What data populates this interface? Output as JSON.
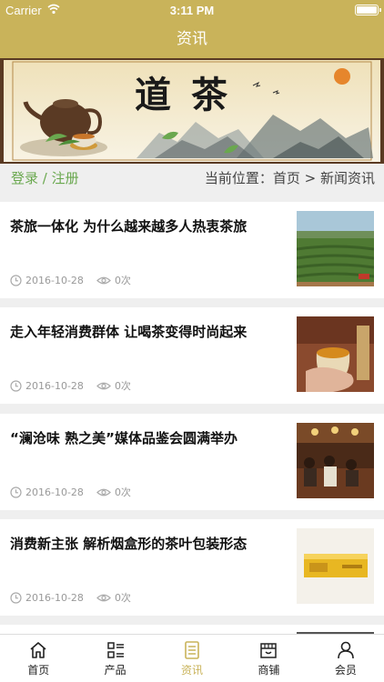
{
  "status": {
    "carrier": "Carrier",
    "time": "3:11 PM"
  },
  "navbar": {
    "title": "资讯"
  },
  "banner": {
    "calligraphy": "道茶"
  },
  "loginbar": {
    "login": "登录",
    "sep": " / ",
    "register": "注册",
    "location": "当前位置：首页 > 新闻资讯"
  },
  "articles": [
    {
      "title": "茶旅一体化 为什么越来越多人热衷茶旅",
      "date": "2016-10-28",
      "views": "0次",
      "thumb": "tea-field"
    },
    {
      "title": "走入年轻消费群体 让喝茶变得时尚起来",
      "date": "2016-10-28",
      "views": "0次",
      "thumb": "tea-cup"
    },
    {
      "title": "“澜沧味 熟之美”媒体品鉴会圆满举办",
      "date": "2016-10-28",
      "views": "0次",
      "thumb": "event-room"
    },
    {
      "title": "消费新主张 解析烟盒形的茶叶包装形态",
      "date": "2016-10-28",
      "views": "0次",
      "thumb": "tea-box"
    }
  ],
  "tabs": [
    {
      "label": "首页",
      "icon": "home-icon"
    },
    {
      "label": "产品",
      "icon": "list-icon"
    },
    {
      "label": "资讯",
      "icon": "news-icon"
    },
    {
      "label": "商铺",
      "icon": "store-icon"
    },
    {
      "label": "会员",
      "icon": "user-icon"
    }
  ],
  "colors": {
    "brand": "#c9b35a",
    "login": "#6aa84f"
  }
}
